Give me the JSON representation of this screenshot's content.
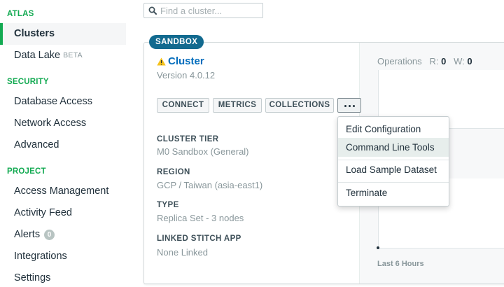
{
  "sidebar": {
    "sections": [
      {
        "title": "ATLAS"
      },
      {
        "title": "SECURITY"
      },
      {
        "title": "PROJECT"
      }
    ],
    "items": [
      {
        "label": "Clusters"
      },
      {
        "label": "Data Lake",
        "badge": "BETA"
      },
      {
        "label": "Database Access"
      },
      {
        "label": "Network Access"
      },
      {
        "label": "Advanced"
      },
      {
        "label": "Access Management"
      },
      {
        "label": "Activity Feed"
      },
      {
        "label": "Alerts",
        "count": "0"
      },
      {
        "label": "Integrations"
      },
      {
        "label": "Settings"
      }
    ]
  },
  "search": {
    "placeholder": "Find a cluster..."
  },
  "cluster": {
    "badge": "SANDBOX",
    "name": "Cluster",
    "version": "Version 4.0.12",
    "buttons": {
      "connect": "CONNECT",
      "metrics": "METRICS",
      "collections": "COLLECTIONS"
    },
    "details": [
      {
        "label": "CLUSTER TIER",
        "value": "M0 Sandbox (General)"
      },
      {
        "label": "REGION",
        "value": "GCP / Taiwan (asia-east1)"
      },
      {
        "label": "TYPE",
        "value": "Replica Set - 3 nodes"
      },
      {
        "label": "LINKED STITCH APP",
        "value": "None Linked"
      }
    ]
  },
  "metrics_panel": {
    "title": "Operations",
    "r_label": "R:",
    "r_value": "0",
    "w_label": "W:",
    "w_value": "0",
    "footer": "Last 6 Hours"
  },
  "menu": {
    "items": [
      {
        "label": "Edit Configuration"
      },
      {
        "label": "Command Line Tools"
      },
      {
        "label": "Load Sample Dataset"
      },
      {
        "label": "Terminate"
      }
    ]
  },
  "colors": {
    "accent_green": "#13aa52",
    "link_blue": "#006cbc",
    "badge_blue": "#126a8f",
    "warning_yellow": "#f5c21b"
  }
}
